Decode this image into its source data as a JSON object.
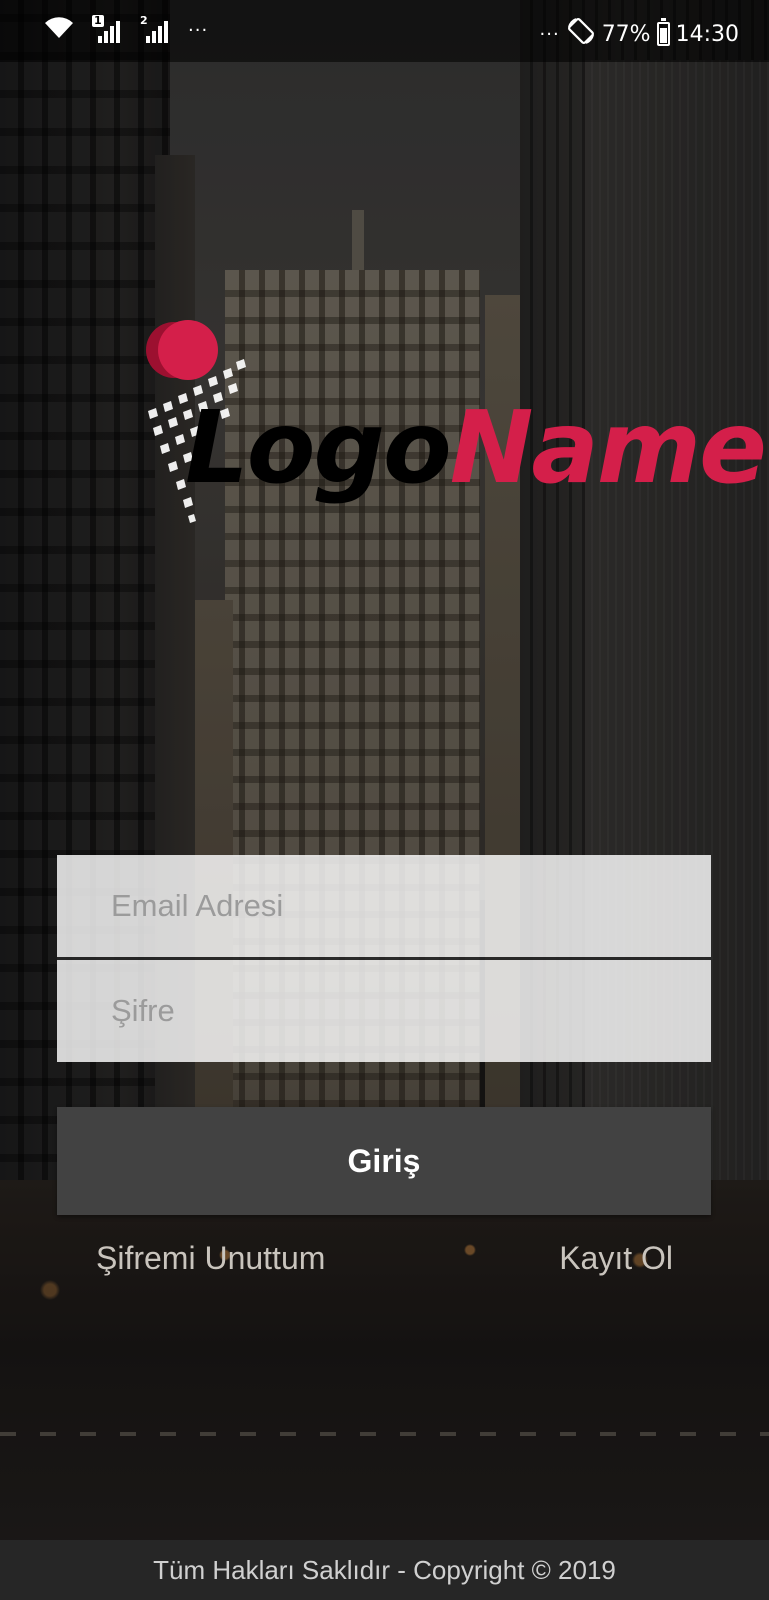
{
  "status_bar": {
    "sim1_label": "1",
    "sim2_label": "2",
    "left_dots": "···",
    "right_dots": "···",
    "battery": "77%",
    "time": "14:30",
    "icons": [
      "wifi-icon",
      "signal-sim1-icon",
      "signal-sim2-icon",
      "screen-rotation-icon",
      "battery-icon"
    ]
  },
  "logo": {
    "word1": "Logo",
    "word2": "Name",
    "colors": {
      "word1": "#000000",
      "word2": "#d41f4a",
      "dot": "#d41f4a"
    }
  },
  "form": {
    "email_placeholder": "Email Adresi",
    "email_value": "",
    "password_placeholder": "Şifre",
    "password_value": "",
    "login_label": "Giriş",
    "forgot_label": "Şifremi Unuttum",
    "register_label": "Kayıt Ol"
  },
  "footer": {
    "text": "Tüm Hakları Saklıdır - Copyright © 2019"
  },
  "colors": {
    "button_bg": "#424242",
    "input_bg": "#ffffffd1",
    "footer_bg": "#262626"
  }
}
